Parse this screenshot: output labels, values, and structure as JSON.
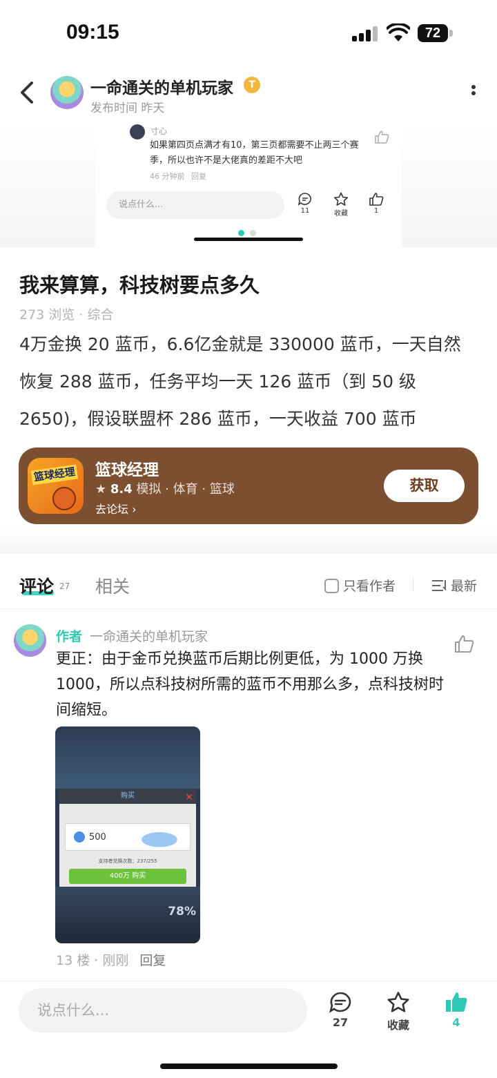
{
  "status_bar": {
    "time": "09:15",
    "battery": "72"
  },
  "header": {
    "author_name": "一命通关的单机玩家",
    "badge": "T",
    "publish_label": "发布时间",
    "publish_time": "昨天"
  },
  "preview": {
    "commenter": "寸心",
    "comment_text": "如果第四页点满才有10，第三页都需要不止两三个赛季，所以也许不是大佬真的差距不大吧",
    "time": "46 分钟前",
    "reply": "回复",
    "input_placeholder": "说点什么...",
    "comment_count": "11",
    "favorite_label": "收藏",
    "like_count": "1"
  },
  "post": {
    "title": "我来算算，科技树要点多久",
    "views": "273 浏览",
    "category": "综合",
    "content": "4万金换 20 蓝币，6.6亿金就是 330000 蓝币，一天自然恢复 288 蓝币，任务平均一天 126 蓝币（到 50 级 2650)，假设联盟杯 286 蓝币，一天收益 700 蓝币"
  },
  "game": {
    "name": "篮球经理",
    "icon_text": "篮球经理",
    "rating": "8.4",
    "tags": "模拟 · 体育 · 篮球",
    "forum_link": "去论坛",
    "get_button": "获取",
    "card_color": "#7b4f2f"
  },
  "tabs": {
    "comments": "评论",
    "comments_count": "27",
    "related": "相关",
    "author_only": "只看作者",
    "sort": "最新",
    "accent": "#3fd3c1"
  },
  "comment": {
    "author_tag": "作者",
    "author_name": "一命通关的单机玩家",
    "text": "更正：由于金币兑换蓝币后期比例更低，为 1000 万换 1000，所以点科技树所需的蓝币不用那么多，点科技树时间缩短。",
    "floor": "13 楼",
    "time": "刚刚",
    "reply": "回复",
    "image": {
      "dialog_title": "购买",
      "amount": "500",
      "note": "支持者兑换次数：237/255",
      "buy_button": "400万 购买",
      "percent": "78%"
    }
  },
  "bottom_bar": {
    "input_placeholder": "说点什么...",
    "comment_count": "27",
    "favorite_label": "收藏",
    "like_count": "4",
    "like_color": "#2fc8b5"
  }
}
